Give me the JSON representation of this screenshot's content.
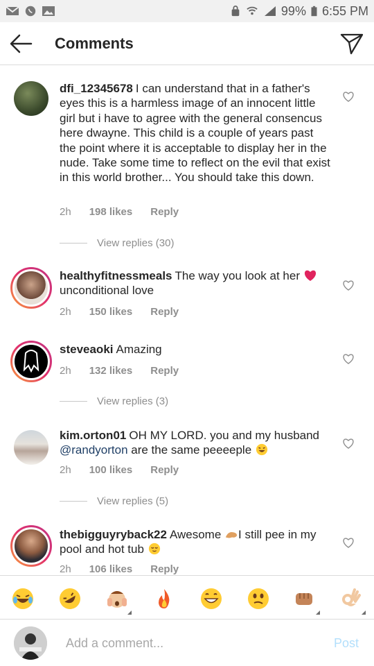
{
  "status_bar": {
    "battery": "99%",
    "time": "6:55 PM"
  },
  "header": {
    "title": "Comments"
  },
  "comments": [
    {
      "username": "dfi_12345678",
      "text": "I can understand that in a father's eyes this is a harmless image of an innocent little girl but i have to agree with the general consencus here dwayne.  This child is a couple of years past the point where it is acceptable to display her in the nude.  Take some time to reflect on the evil that exist in this world brother... You should take this down.",
      "time": "2h",
      "likes": "198 likes",
      "reply": "Reply",
      "view_replies": "View replies (30)"
    },
    {
      "username": "healthyfitnessmeals",
      "text_before": "The way you look at her",
      "text_after": "unconditional love",
      "time": "2h",
      "likes": "150 likes",
      "reply": "Reply"
    },
    {
      "username": "steveaoki",
      "text": "Amazing",
      "time": "2h",
      "likes": "132 likes",
      "reply": "Reply",
      "view_replies": "View replies (3)"
    },
    {
      "username": "kim.orton01",
      "text_before": "OH MY LORD. you and my husband",
      "mention": "@randyorton",
      "text_after": "are the same peeeeple",
      "time": "2h",
      "likes": "100 likes",
      "reply": "Reply",
      "view_replies": "View replies (5)"
    },
    {
      "username": "thebigguyryback22",
      "text_before": "Awesome",
      "text_mid": "I still pee in my pool and hot tub",
      "time": "2h",
      "likes": "106 likes",
      "reply": "Reply"
    }
  ],
  "emoji_bar": [
    "joy-emoji",
    "rofl-emoji",
    "hands-on-face-emoji",
    "fire-emoji",
    "grin-emoji",
    "woozy-emoji",
    "fist-emoji",
    "ok-hand-emoji"
  ],
  "composer": {
    "placeholder": "Add a comment...",
    "post_label": "Post"
  },
  "colors": {
    "link_blue": "#b2dffc",
    "mention_blue": "#1f3f66",
    "muted": "#8e8e8e",
    "story_ring": "#e1306c"
  }
}
